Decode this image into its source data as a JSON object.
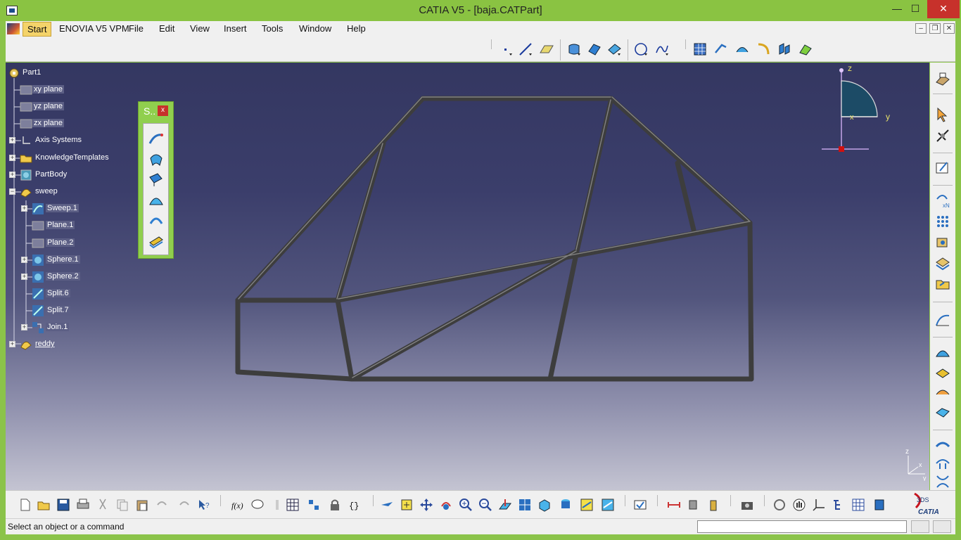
{
  "window": {
    "title": "CATIA V5 - [baja.CATPart]",
    "minimize": "—",
    "maximize": "☐",
    "close": "✕"
  },
  "menu": {
    "items": [
      "Start",
      "ENOVIA V5 VPM",
      "File",
      "Edit",
      "View",
      "Insert",
      "Tools",
      "Window",
      "Help"
    ],
    "mdi_min": "–",
    "mdi_restore": "❐",
    "mdi_close": "✕"
  },
  "tree": {
    "root": "Part1",
    "nodes": [
      {
        "label": "xy plane"
      },
      {
        "label": "yz plane"
      },
      {
        "label": "zx plane"
      },
      {
        "label": "Axis Systems"
      },
      {
        "label": "KnowledgeTemplates"
      },
      {
        "label": "PartBody"
      },
      {
        "label": "sweep"
      },
      {
        "label": "Sweep.1"
      },
      {
        "label": "Plane.1"
      },
      {
        "label": "Plane.2"
      },
      {
        "label": "Sphere.1"
      },
      {
        "label": "Sphere.2"
      },
      {
        "label": "Split.6"
      },
      {
        "label": "Split.7"
      },
      {
        "label": "Join.1"
      },
      {
        "label": "reddy"
      }
    ]
  },
  "sweep_toolbar": {
    "caption": "S..",
    "close": "x"
  },
  "compass": {
    "z": "z",
    "x": "x",
    "y": "y"
  },
  "mini_axis": {
    "z": "z",
    "x": "x",
    "y": "y"
  },
  "status": {
    "message": "Select an object or a command",
    "power_input": ""
  },
  "brand": {
    "logo_text": "CATIA",
    "logo_mark": "3DS"
  },
  "colors": {
    "window_frame": "#8ac342",
    "viewport_top": "#343761",
    "viewport_bottom": "#c4c4d2",
    "frame_tube": "#4a4a4a",
    "close_red": "#c7312b"
  }
}
